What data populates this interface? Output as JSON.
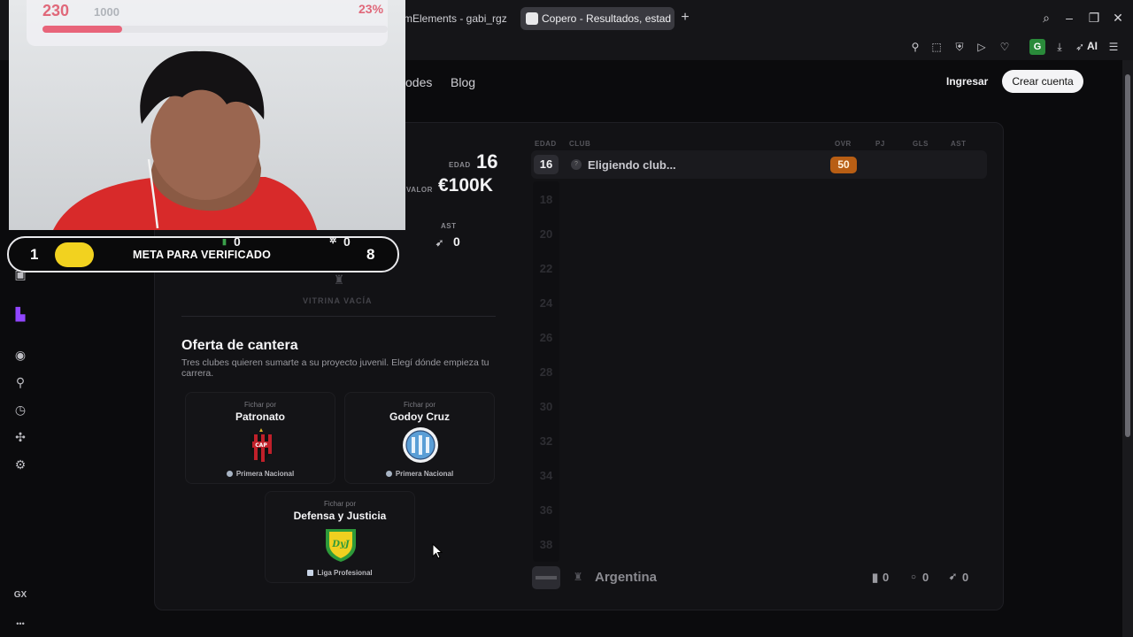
{
  "browser": {
    "tabs": [
      {
        "label": "mElements - gabi_rgz",
        "active": false
      },
      {
        "label": "Copero - Resultados, estad",
        "active": true
      }
    ],
    "new_tab": "+",
    "toolbar_ext": "G",
    "toolbar_ai": "AI"
  },
  "sidebar": {
    "icons": [
      "camera-icon",
      "image-icon",
      "twitch-icon",
      "play-icon",
      "pin-icon",
      "history-icon",
      "puzzle-icon",
      "settings-icon"
    ],
    "bottom_label": "GX",
    "more": "•••"
  },
  "site": {
    "nav_partial": "odes",
    "nav_blog": "Blog",
    "login": "Ingresar",
    "signup": "Crear cuenta"
  },
  "player": {
    "age_label": "EDAD",
    "age": "16",
    "value_label": "VALOR",
    "value": "€100K",
    "ast_label": "AST",
    "ast": "0",
    "stat_a": "0",
    "stat_b": "0",
    "showcase": "VITRINA VACÍA"
  },
  "offer": {
    "title": "Oferta de cantera",
    "description": "Tres clubes quieren sumarte a su proyecto juvenil. Elegí dónde empieza tu carrera.",
    "clubs": [
      {
        "prefix": "Fichar por",
        "name": "Patronato",
        "league": "Primera Nacional",
        "colors": [
          "#c0202a",
          "#111111"
        ]
      },
      {
        "prefix": "Fichar por",
        "name": "Godoy Cruz",
        "league": "Primera Nacional",
        "colors": [
          "#6aa8dc",
          "#ffffff"
        ]
      },
      {
        "prefix": "Fichar por",
        "name": "Defensa y Justicia",
        "league": "Liga Profesional",
        "colors": [
          "#f0d020",
          "#2e9a3a"
        ]
      }
    ]
  },
  "career": {
    "headers": {
      "age": "EDAD",
      "club": "CLUB",
      "ovr": "OVR",
      "pj": "PJ",
      "gls": "GLS",
      "ast": "AST"
    },
    "current": {
      "age": "16",
      "club": "Eligiendo club...",
      "ovr": "50"
    },
    "future_ages": [
      "18",
      "20",
      "22",
      "24",
      "26",
      "28",
      "30",
      "32",
      "34",
      "36",
      "38"
    ],
    "country": "Argentina",
    "totals": {
      "a": "0",
      "b": "0",
      "c": "0"
    }
  },
  "overlay": {
    "webcam_count": "230",
    "webcam_total": "1000",
    "webcam_pct": "23%",
    "webcam_progress": 0.23,
    "goal_left": "1",
    "goal_text": "META PARA VERIFICADO",
    "goal_right": "8"
  }
}
